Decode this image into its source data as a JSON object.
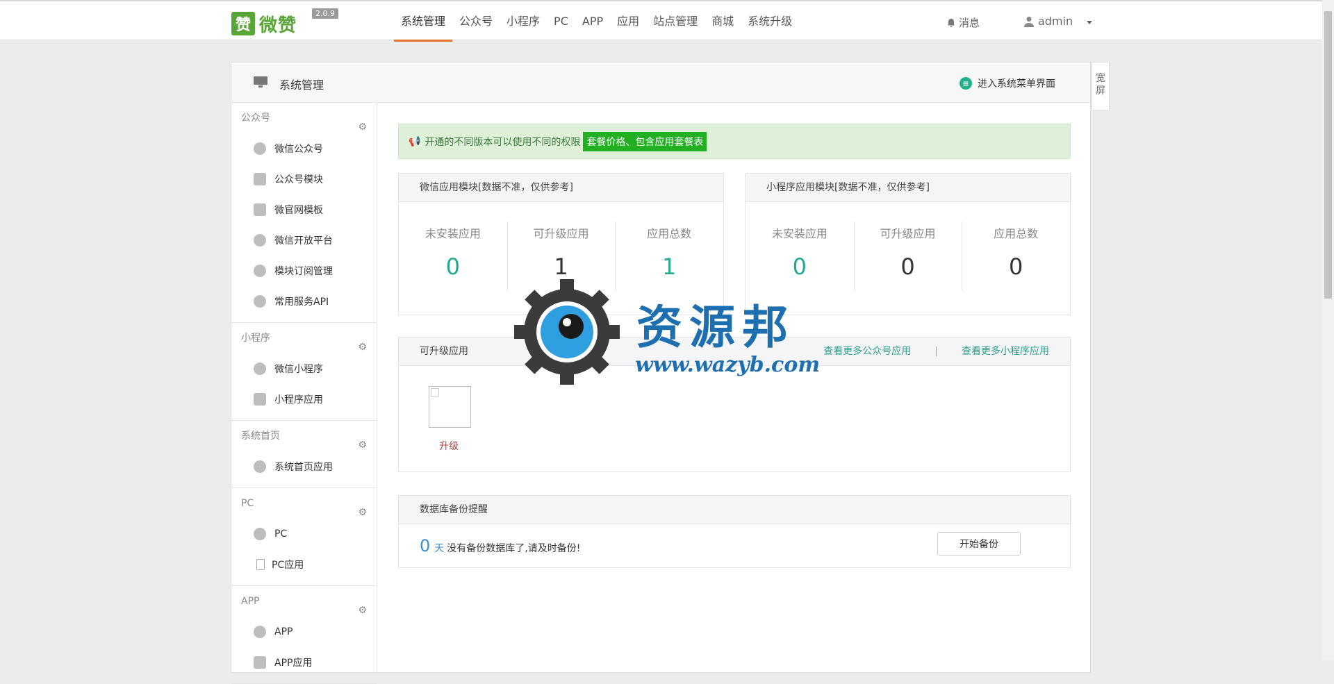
{
  "header": {
    "logo_text": "微赞",
    "version": "2.0.9",
    "nav": [
      "系统管理",
      "公众号",
      "小程序",
      "PC",
      "APP",
      "应用",
      "站点管理",
      "商城",
      "系统升级"
    ],
    "messages_label": "消息",
    "user": "admin"
  },
  "panel": {
    "title": "系统管理",
    "enter_menu": "进入系统菜单界面",
    "wide_label": "宽屏"
  },
  "sidebar": {
    "groups": [
      {
        "title": "公众号",
        "items": [
          "微信公众号",
          "公众号模块",
          "微官网模板",
          "微信开放平台",
          "模块订阅管理",
          "常用服务API"
        ]
      },
      {
        "title": "小程序",
        "items": [
          "微信小程序",
          "小程序应用"
        ]
      },
      {
        "title": "系统首页",
        "items": [
          "系统首页应用"
        ]
      },
      {
        "title": "PC",
        "items": [
          "PC",
          "PC应用"
        ]
      },
      {
        "title": "APP",
        "items": [
          "APP",
          "APP应用"
        ]
      }
    ]
  },
  "alert": {
    "text": "开通的不同版本可以使用不同的权限",
    "badge": "套餐价格、包含应用套餐表"
  },
  "wechat_stats": {
    "title": "微信应用模块[数据不准，仅供参考]",
    "labels": [
      "未安装应用",
      "可升级应用",
      "应用总数"
    ],
    "values": [
      "0",
      "1",
      "1"
    ]
  },
  "mini_stats": {
    "title": "小程序应用模块[数据不准，仅供参考]",
    "labels": [
      "未安装应用",
      "可升级应用",
      "应用总数"
    ],
    "values": [
      "0",
      "0",
      "0"
    ]
  },
  "upgrade": {
    "title": "可升级应用",
    "link_wechat": "查看更多公众号应用",
    "separator": "|",
    "link_mini": "查看更多小程序应用",
    "item_label": "升级"
  },
  "backup": {
    "title": "数据库备份提醒",
    "days": "0",
    "unit": "天",
    "text": "没有备份数据库了,请及时备份!",
    "button": "开始备份"
  },
  "watermark": {
    "text": "资源邦",
    "url": "www.wazyb.com"
  }
}
